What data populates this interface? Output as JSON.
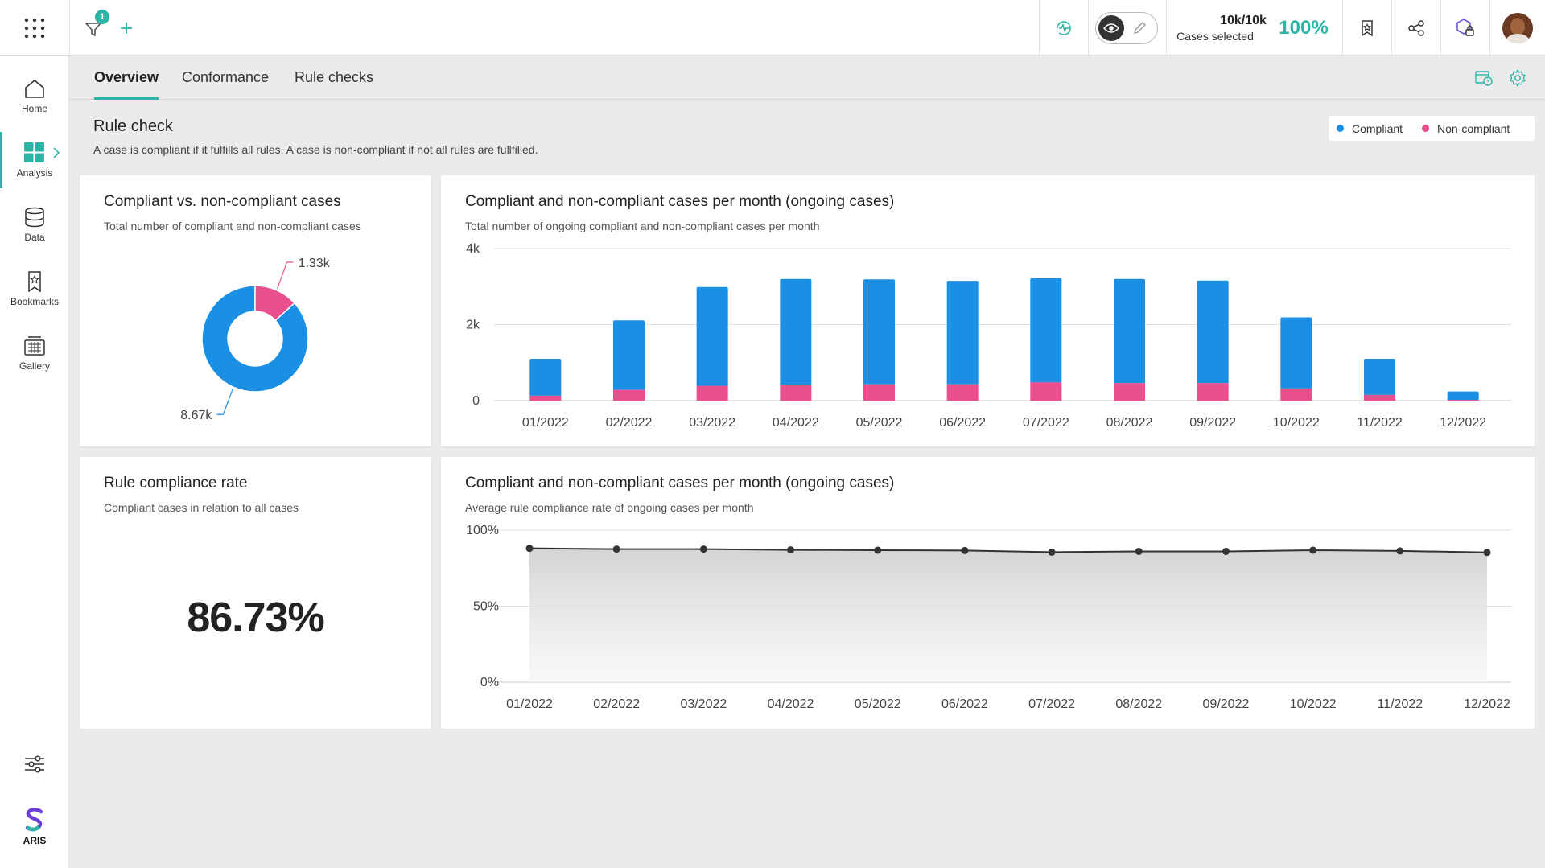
{
  "header": {
    "filter_badge": "1",
    "cases_count": "10k/10k",
    "cases_label": "Cases selected",
    "cases_percent": "100%"
  },
  "sidebar": {
    "items": [
      {
        "label": "Home",
        "icon": "home-icon"
      },
      {
        "label": "Analysis",
        "icon": "grid-icon"
      },
      {
        "label": "Data",
        "icon": "database-icon"
      },
      {
        "label": "Bookmarks",
        "icon": "bookmark-icon"
      },
      {
        "label": "Gallery",
        "icon": "gallery-icon"
      }
    ],
    "brand": "ARIS"
  },
  "tabs": [
    {
      "label": "Overview",
      "active": true
    },
    {
      "label": "Conformance",
      "active": false
    },
    {
      "label": "Rule checks",
      "active": false
    }
  ],
  "section": {
    "title": "Rule check",
    "description": "A case is compliant if it fulfills all rules. A case is non-compliant if not all rules are fullfilled."
  },
  "legend": {
    "compliant": "Compliant",
    "non_compliant": "Non-compliant"
  },
  "colors": {
    "compliant": "#1a8fe3",
    "non_compliant": "#e84f8c",
    "accent": "#2bb5a6"
  },
  "cards": {
    "donut": {
      "title": "Compliant vs. non-compliant cases",
      "subtitle": "Total number of compliant and non-compliant cases"
    },
    "bar": {
      "title": "Compliant and non-compliant cases per month (ongoing cases)",
      "subtitle": "Total number of ongoing compliant and non-compliant cases per month"
    },
    "rate": {
      "title": "Rule compliance rate",
      "subtitle": "Compliant cases in relation to all cases",
      "value": "86.73%"
    },
    "line": {
      "title": "Compliant and non-compliant cases per month (ongoing cases)",
      "subtitle": "Average rule compliance rate of ongoing cases per month"
    }
  },
  "chart_data": [
    {
      "type": "pie",
      "title": "Compliant vs. non-compliant cases",
      "labels": [
        "Compliant",
        "Non-compliant"
      ],
      "values": [
        8670,
        1330
      ],
      "data_labels": [
        "8.67k",
        "1.33k"
      ],
      "donut": true
    },
    {
      "type": "bar",
      "stacked": true,
      "title": "Compliant and non-compliant cases per month (ongoing cases)",
      "categories": [
        "01/2022",
        "02/2022",
        "03/2022",
        "04/2022",
        "05/2022",
        "06/2022",
        "07/2022",
        "08/2022",
        "09/2022",
        "10/2022",
        "11/2022",
        "12/2022"
      ],
      "series": [
        {
          "name": "Non-compliant",
          "values": [
            130,
            280,
            390,
            420,
            430,
            430,
            480,
            460,
            460,
            320,
            150,
            20
          ]
        },
        {
          "name": "Compliant",
          "values": [
            970,
            1830,
            2600,
            2780,
            2760,
            2720,
            2740,
            2740,
            2700,
            1870,
            950,
            220
          ]
        }
      ],
      "yticks": [
        "0",
        "2k",
        "4k"
      ],
      "ylim": [
        0,
        4000
      ],
      "grid": true
    },
    {
      "type": "area",
      "title": "Compliant and non-compliant cases per month (ongoing cases)",
      "categories": [
        "01/2022",
        "02/2022",
        "03/2022",
        "04/2022",
        "05/2022",
        "06/2022",
        "07/2022",
        "08/2022",
        "09/2022",
        "10/2022",
        "11/2022",
        "12/2022"
      ],
      "values": [
        88,
        87.5,
        87.5,
        87,
        86.8,
        86.6,
        85.5,
        86,
        86,
        86.8,
        86.3,
        85.3
      ],
      "yticks": [
        "0%",
        "50%",
        "100%"
      ],
      "ylim": [
        0,
        100
      ],
      "grid": true
    }
  ]
}
